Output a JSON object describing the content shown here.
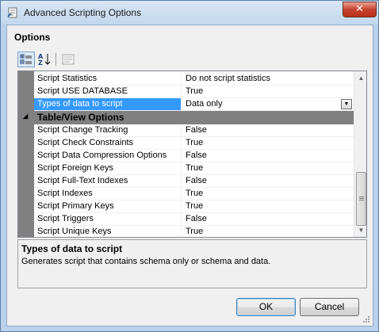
{
  "window": {
    "title": "Advanced Scripting Options",
    "close_glyph": "✕"
  },
  "section_header": "Options",
  "toolbar": {
    "categorized_icon": "categorized-icon",
    "alphabetical_icon": "sort-alphabetical-icon",
    "property_pages_icon": "property-pages-icon"
  },
  "grid": {
    "rows_before": [
      {
        "name": "Script Statistics",
        "value": "Do not script statistics"
      },
      {
        "name": "Script USE DATABASE",
        "value": "True"
      }
    ],
    "selected_row": {
      "name": "Types of data to script",
      "value": "Data only",
      "dropdown_glyph": "▼"
    },
    "category": {
      "toggle_glyph": "◢",
      "label": "Table/View Options"
    },
    "rows_after": [
      {
        "name": "Script Change Tracking",
        "value": "False"
      },
      {
        "name": "Script Check Constraints",
        "value": "True"
      },
      {
        "name": "Script Data Compression Options",
        "value": "False"
      },
      {
        "name": "Script Foreign Keys",
        "value": "True"
      },
      {
        "name": "Script Full-Text Indexes",
        "value": "False"
      },
      {
        "name": "Script Indexes",
        "value": "True"
      },
      {
        "name": "Script Primary Keys",
        "value": "True"
      },
      {
        "name": "Script Triggers",
        "value": "False"
      },
      {
        "name": "Script Unique Keys",
        "value": "True"
      }
    ],
    "scroll_up_glyph": "▲",
    "scroll_down_glyph": "▼"
  },
  "description": {
    "title": "Types of data to script",
    "text": "Generates script that contains schema only or schema and data."
  },
  "buttons": {
    "ok": "OK",
    "cancel": "Cancel"
  },
  "colors": {
    "selection": "#3399ff",
    "category_bg": "#808080",
    "window_frame": "#b9d1ea"
  }
}
